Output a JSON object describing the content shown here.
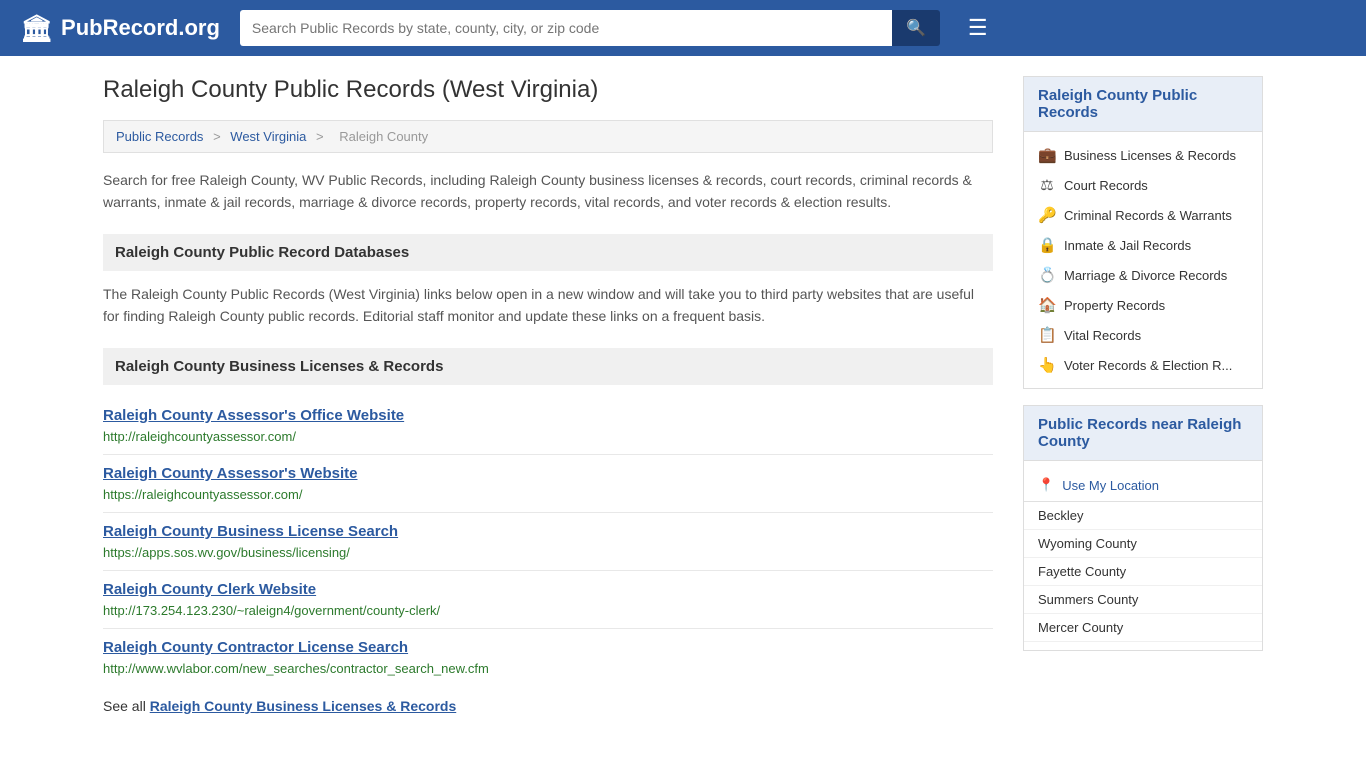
{
  "header": {
    "logo_icon": "🏛",
    "logo_text": "PubRecord.org",
    "search_placeholder": "Search Public Records by state, county, city, or zip code",
    "search_icon": "🔍",
    "menu_icon": "☰"
  },
  "page": {
    "title": "Raleigh County Public Records (West Virginia)",
    "breadcrumb": {
      "parts": [
        "Public Records",
        "West Virginia",
        "Raleigh County"
      ],
      "separators": [
        ">",
        ">"
      ]
    },
    "description": "Search for free Raleigh County, WV Public Records, including Raleigh County business licenses & records, court records, criminal records & warrants, inmate & jail records, marriage & divorce records, property records, vital records, and voter records & election results.",
    "databases_header": "Raleigh County Public Record Databases",
    "databases_description": "The Raleigh County Public Records (West Virginia) links below open in a new window and will take you to third party websites that are useful for finding Raleigh County public records. Editorial staff monitor and update these links on a frequent basis.",
    "business_header": "Raleigh County Business Licenses & Records",
    "records": [
      {
        "title": "Raleigh County Assessor's Office Website",
        "url": "http://raleighcountyassessor.com/"
      },
      {
        "title": "Raleigh County Assessor's Website",
        "url": "https://raleighcountyassessor.com/"
      },
      {
        "title": "Raleigh County Business License Search",
        "url": "https://apps.sos.wv.gov/business/licensing/"
      },
      {
        "title": "Raleigh County Clerk Website",
        "url": "http://173.254.123.230/~raleign4/government/county-clerk/"
      },
      {
        "title": "Raleigh County Contractor License Search",
        "url": "http://www.wvlabor.com/new_searches/contractor_search_new.cfm"
      }
    ],
    "see_all_text": "See all ",
    "see_all_link": "Raleigh County Business Licenses & Records"
  },
  "sidebar": {
    "public_records_header": "Raleigh County Public Records",
    "links": [
      {
        "icon": "💼",
        "label": "Business Licenses & Records"
      },
      {
        "icon": "⚖",
        "label": "Court Records"
      },
      {
        "icon": "🔑",
        "label": "Criminal Records & Warrants"
      },
      {
        "icon": "🔒",
        "label": "Inmate & Jail Records"
      },
      {
        "icon": "💍",
        "label": "Marriage & Divorce Records"
      },
      {
        "icon": "🏠",
        "label": "Property Records"
      },
      {
        "icon": "📋",
        "label": "Vital Records"
      },
      {
        "icon": "👆",
        "label": "Voter Records & Election R..."
      }
    ],
    "near_header": "Public Records near Raleigh County",
    "use_location_icon": "📍",
    "use_location_label": "Use My Location",
    "nearby": [
      "Beckley",
      "Wyoming County",
      "Fayette County",
      "Summers County",
      "Mercer County"
    ]
  }
}
